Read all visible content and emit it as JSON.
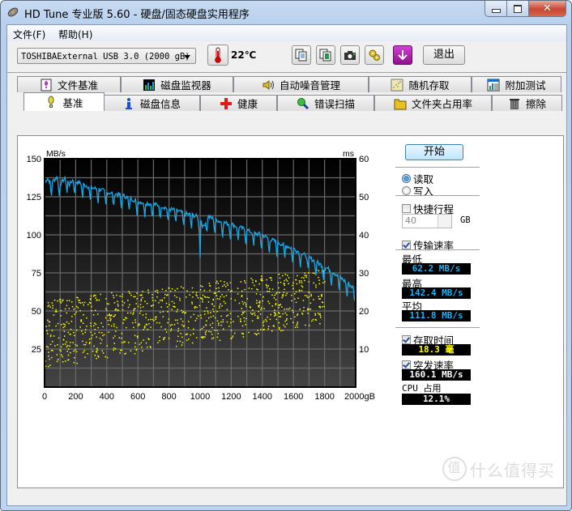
{
  "window": {
    "title": "HD Tune 专业版 5.60 - 硬盘/固态硬盘实用程序",
    "app_icon": "hdtune-disk-icon",
    "controls": {
      "minimize": "minimize-icon",
      "maximize": "maximize-icon",
      "close": "close-icon"
    }
  },
  "menu": {
    "items": [
      {
        "label": "文件(F)",
        "accel": "F"
      },
      {
        "label": "帮助(H)",
        "accel": "H"
      }
    ]
  },
  "toolbar": {
    "drive": "TOSHIBAExternal USB 3.0 (2000 gB)",
    "temperature": "22℃",
    "icons": [
      "thermometer-icon",
      "copy-text-icon",
      "copy-image-icon",
      "screenshot-camera-icon",
      "options-gear-icon",
      "save-download-icon"
    ],
    "exit_label": "退出"
  },
  "tabs": {
    "row1": [
      {
        "label": "文件基准",
        "icon": "file-benchmark-icon"
      },
      {
        "label": "磁盘监视器",
        "icon": "disk-monitor-icon"
      },
      {
        "label": "自动噪音管理",
        "icon": "speaker-icon"
      },
      {
        "label": "随机存取",
        "icon": "random-access-icon"
      },
      {
        "label": "附加测试",
        "icon": "extra-tests-icon"
      }
    ],
    "row2": [
      {
        "label": "基准",
        "icon": "benchmark-exclamation-icon",
        "active": true
      },
      {
        "label": "磁盘信息",
        "icon": "info-icon"
      },
      {
        "label": "健康",
        "icon": "health-cross-icon"
      },
      {
        "label": "错误扫描",
        "icon": "magnifier-icon"
      },
      {
        "label": "文件夹占用率",
        "icon": "folder-icon"
      },
      {
        "label": "擦除",
        "icon": "trash-icon"
      }
    ]
  },
  "side": {
    "start_label": "开始",
    "read_label": "读取",
    "write_label": "写入",
    "read_selected": true,
    "short_stroke_label": "快捷行程",
    "short_stroke_checked": false,
    "short_stroke_value": "40",
    "short_stroke_unit": "GB",
    "transfer_rate_label": "传输速率",
    "transfer_rate_checked": true,
    "min_label": "最低",
    "min_value": "62.2 MB/s",
    "max_label": "最高",
    "max_value": "142.4 MB/s",
    "avg_label": "平均",
    "avg_value": "111.8 MB/s",
    "access_time_label": "存取时间",
    "access_time_checked": true,
    "access_time_value": "18.3 毫",
    "burst_rate_label": "突发速率",
    "burst_rate_checked": true,
    "burst_rate_value": "160.1 MB/s",
    "cpu_label": "CPU 占用",
    "cpu_value": "12.1%",
    "colors": {
      "lcd_blue": "#20b0f0",
      "lcd_yellow": "#ffff00",
      "lcd_white": "#ffffff"
    }
  },
  "chart_data": {
    "type": "line",
    "title": "",
    "xlabel": "gB",
    "ylabel_left": "MB/s",
    "ylabel_right": "ms",
    "xlim": [
      0,
      2000
    ],
    "ylim_left": [
      0,
      150
    ],
    "ylim_right": [
      0,
      60
    ],
    "x_ticks": [
      "0",
      "200",
      "400",
      "600",
      "800",
      "1000",
      "1200",
      "1400",
      "1600",
      "1800",
      "2000gB"
    ],
    "y_ticks_left": [
      "150",
      "125",
      "100",
      "75",
      "50",
      "25"
    ],
    "y_ticks_right": [
      "60",
      "50",
      "40",
      "30",
      "20",
      "10"
    ],
    "grid": true,
    "series": [
      {
        "name": "Transfer rate (MB/s)",
        "color": "#1aa8e8",
        "axis": "left",
        "x": [
          0,
          20,
          40,
          60,
          80,
          100,
          120,
          140,
          160,
          180,
          200,
          250,
          300,
          350,
          400,
          450,
          500,
          550,
          600,
          650,
          700,
          750,
          800,
          850,
          900,
          950,
          980,
          1000,
          1020,
          1050,
          1100,
          1150,
          1200,
          1250,
          1300,
          1350,
          1400,
          1450,
          1500,
          1550,
          1600,
          1650,
          1700,
          1750,
          1800,
          1850,
          1900,
          1950,
          2000
        ],
        "values": [
          135,
          137,
          134,
          136,
          138,
          133,
          136,
          137,
          133,
          136,
          135,
          133,
          131,
          130,
          128,
          127,
          126,
          124,
          122,
          121,
          120,
          119,
          117,
          116,
          114,
          113,
          112,
          111,
          105,
          112,
          110,
          108,
          107,
          105,
          103,
          101,
          100,
          97,
          95,
          93,
          91,
          88,
          85,
          82,
          79,
          76,
          72,
          68,
          64
        ]
      },
      {
        "name": "Access time (ms)",
        "color": "#ffff00",
        "axis": "right",
        "type": "scatter",
        "description": "scattered points, roughly 6–20 ms near 0 GB rising to ~16–28 ms near 1800 GB"
      }
    ]
  }
}
